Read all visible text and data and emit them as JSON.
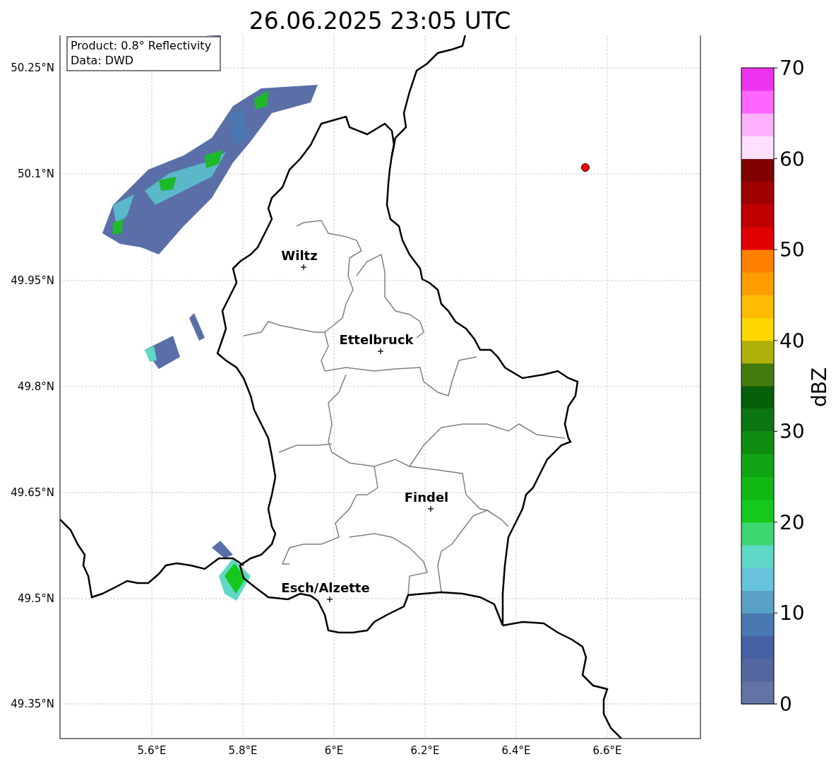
{
  "title": "26.06.2025 23:05 UTC",
  "info_box": {
    "lines": [
      "Product: 0.8° Reflectivity",
      "Data: DWD"
    ]
  },
  "map": {
    "lat_ticks": [
      "50.25°N",
      "50.1°N",
      "49.95°N",
      "49.8°N",
      "49.65°N",
      "49.5°N",
      "49.35°N"
    ],
    "lon_ticks": [
      "5.6°E",
      "5.8°E",
      "6°E",
      "6.2°E",
      "6.4°E",
      "6.6°E"
    ],
    "places": [
      {
        "name": "Wiltz"
      },
      {
        "name": "Ettelbruck"
      },
      {
        "name": "Findel"
      },
      {
        "name": "Esch/Alzette"
      }
    ]
  },
  "colorbar": {
    "label": "dBZ",
    "ticks": [
      "70",
      "60",
      "50",
      "40",
      "30",
      "20",
      "10",
      "0"
    ],
    "bins": [
      {
        "color": "#6273a6"
      },
      {
        "color": "#53669f"
      },
      {
        "color": "#4760a2"
      },
      {
        "color": "#4a78b0"
      },
      {
        "color": "#5a9fc6"
      },
      {
        "color": "#66c2dd"
      },
      {
        "color": "#5fd8c6"
      },
      {
        "color": "#3ed671"
      },
      {
        "color": "#14c91b"
      },
      {
        "color": "#11b814"
      },
      {
        "color": "#10a412"
      },
      {
        "color": "#0e8c10"
      },
      {
        "color": "#0b760f"
      },
      {
        "color": "#075f0a"
      },
      {
        "color": "#457a0c"
      },
      {
        "color": "#b0b00a"
      },
      {
        "color": "#ffd700"
      },
      {
        "color": "#ffbb00"
      },
      {
        "color": "#ff9d00"
      },
      {
        "color": "#ff8000"
      },
      {
        "color": "#e00000"
      },
      {
        "color": "#c00000"
      },
      {
        "color": "#a00000"
      },
      {
        "color": "#800000"
      },
      {
        "color": "#ffe0ff"
      },
      {
        "color": "#ffb0ff"
      },
      {
        "color": "#ff66ff"
      },
      {
        "color": "#ee33ee"
      }
    ]
  }
}
